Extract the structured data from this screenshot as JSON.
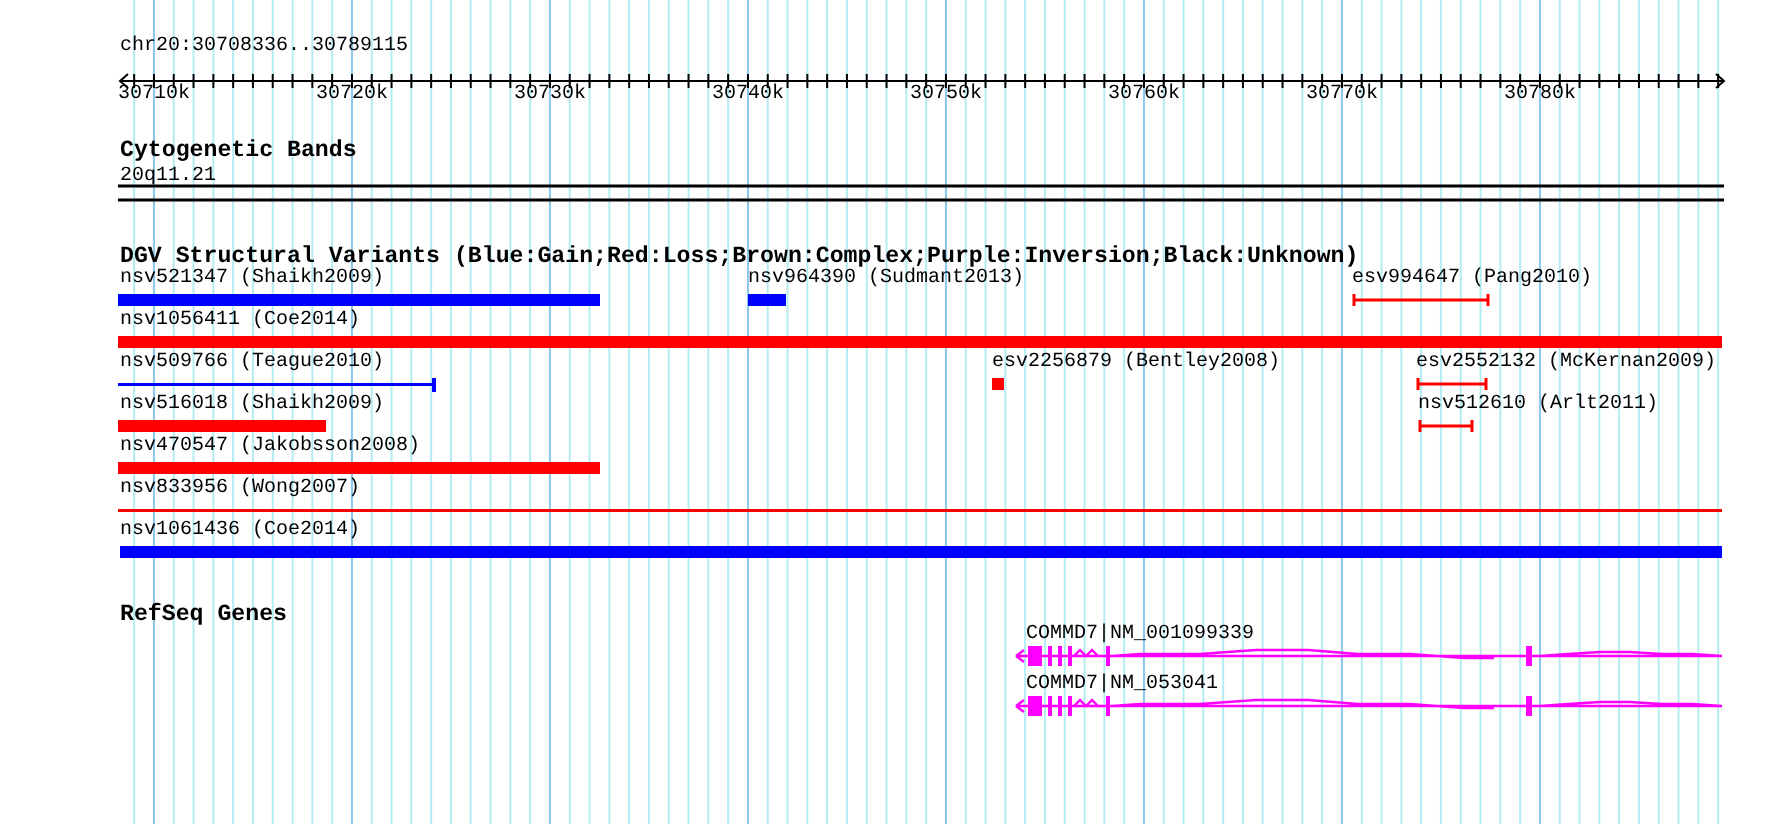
{
  "ruler": {
    "location": "chr20:30708336..30789115",
    "ticks": [
      "30710k",
      "30720k",
      "30730k",
      "30740k",
      "30750k",
      "30760k",
      "30770k",
      "30780k"
    ]
  },
  "cytogenetic_bands": {
    "title": "Cytogenetic Bands",
    "band": "20q11.21"
  },
  "structural_variants": {
    "title": "DGV Structural Variants (Blue:Gain;Red:Loss;Brown:Complex;Purple:Inversion;Black:Unknown)",
    "features": [
      {
        "label": "nsv521347 (Shaikh2009)",
        "kind": "bar",
        "color": "#0000ff"
      },
      {
        "label": "nsv964390 (Sudmant2013)",
        "kind": "bar",
        "color": "#0000ff"
      },
      {
        "label": "esv994647 (Pang2010)",
        "kind": "capped",
        "color": "#ff0000"
      },
      {
        "label": "nsv1056411 (Coe2014)",
        "kind": "bar",
        "color": "#ff0000"
      },
      {
        "label": "nsv509766 (Teague2010)",
        "kind": "line",
        "color": "#0000ff"
      },
      {
        "label": "esv2256879 (Bentley2008)",
        "kind": "bar",
        "color": "#ff0000"
      },
      {
        "label": "esv2552132 (McKernan2009)",
        "kind": "capped",
        "color": "#ff0000"
      },
      {
        "label": "nsv516018 (Shaikh2009)",
        "kind": "bar",
        "color": "#ff0000"
      },
      {
        "label": "nsv512610 (Arlt2011)",
        "kind": "capped",
        "color": "#ff0000"
      },
      {
        "label": "nsv470547 (Jakobsson2008)",
        "kind": "bar",
        "color": "#ff0000"
      },
      {
        "label": "nsv833956 (Wong2007)",
        "kind": "line",
        "color": "#ff0000"
      },
      {
        "label": "nsv1061436 (Coe2014)",
        "kind": "bar",
        "color": "#0000ff"
      }
    ]
  },
  "refseq_genes": {
    "title": "RefSeq Genes",
    "genes": [
      {
        "label": "COMMD7|NM_001099339"
      },
      {
        "label": "COMMD7|NM_053041"
      }
    ]
  }
}
